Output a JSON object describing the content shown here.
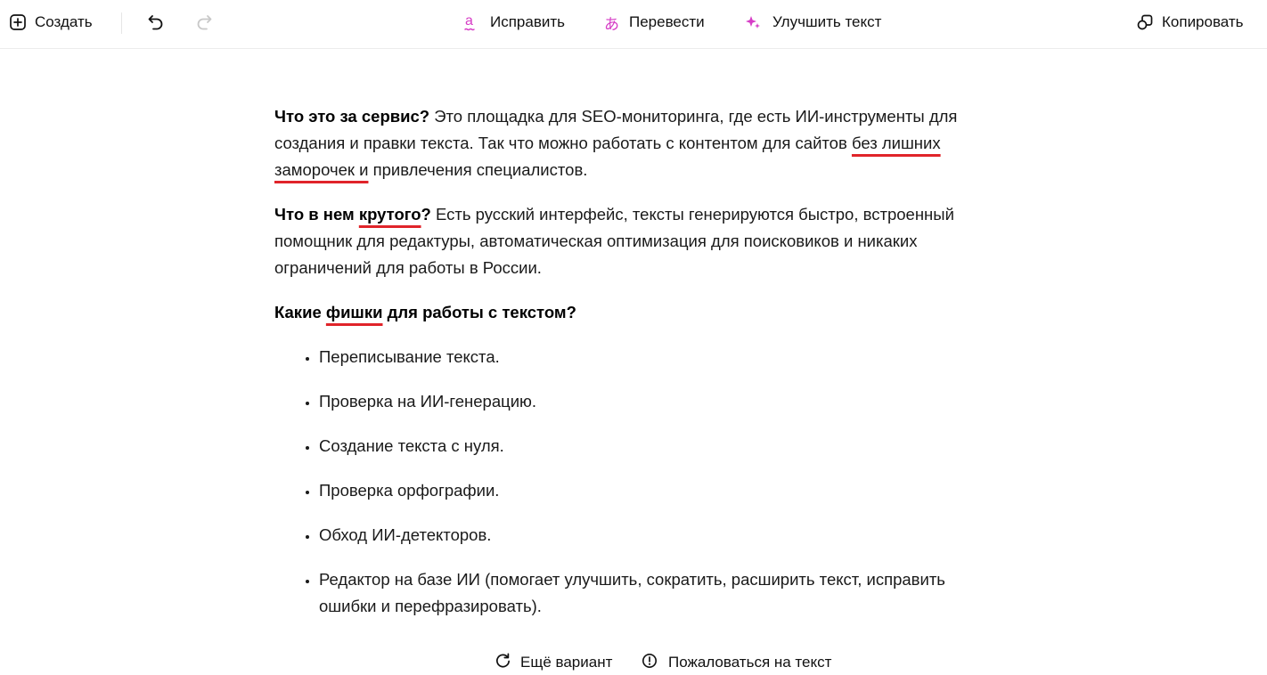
{
  "toolbar": {
    "create_label": "Создать",
    "fix_label": "Исправить",
    "translate_label": "Перевести",
    "improve_label": "Улучшить текст",
    "copy_label": "Копировать"
  },
  "content": {
    "p1": {
      "bold": "Что это за сервис?",
      "text_a": " Это площадка для SEO-мониторинга, где есть ИИ-инструменты для создания и правки текста. Так что можно работать с контентом для сайтов ",
      "flagged": "без лишних заморочек и",
      "text_b": " привлечения специалистов."
    },
    "p2": {
      "bold_a": "Что в нем ",
      "bold_flagged": "крутого",
      "bold_b": "?",
      "text": " Есть русский интерфейс, тексты генерируются быстро, встроенный помощник для редактуры, автоматическая оптимизация для поисковиков и никаких ограничений для работы в России."
    },
    "h3": {
      "bold_a": "Какие ",
      "bold_flagged": "фишки",
      "bold_b": " для работы с текстом?"
    },
    "features": [
      "Переписывание текста.",
      "Проверка на ИИ-генерацию.",
      "Создание текста с нуля.",
      "Проверка орфографии.",
      "Обход ИИ-детекторов.",
      "Редактор на базе ИИ (помогает улучшить, сократить, расширить текст, исправить ошибки и перефразировать)."
    ]
  },
  "footer": {
    "another_label": "Ещё вариант",
    "report_label": "Пожаловаться на текст"
  },
  "colors": {
    "accent_pink": "#d63dc6",
    "spellcheck_red": "#e0242a",
    "disabled_gray": "#c8c8c8"
  }
}
